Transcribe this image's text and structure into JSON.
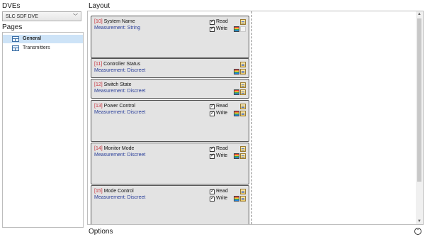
{
  "dves_header": "DVEs",
  "dve_selector": {
    "value": "SLC SDF DVE"
  },
  "pages_header": "Pages",
  "pages": [
    {
      "label": "General",
      "selected": true
    },
    {
      "label": "Transmitters",
      "selected": false
    }
  ],
  "layout_header": "Layout",
  "cards": [
    {
      "pid": "[10]",
      "name": "System Name",
      "measurement": "Measurement: String",
      "read_label": "Read",
      "write_label": "Write"
    },
    {
      "pid": "[11]",
      "name": "Controller Status",
      "measurement": "Measurement: Discreet"
    },
    {
      "pid": "[12]",
      "name": "Switch State",
      "measurement": "Measurement: Discreet"
    },
    {
      "pid": "[13]",
      "name": "Power Control",
      "measurement": "Measurement: Discreet",
      "read_label": "Read",
      "write_label": "Write"
    },
    {
      "pid": "[14]",
      "name": "Monitor Mode",
      "measurement": "Measurement: Discreet",
      "read_label": "Read",
      "write_label": "Write"
    },
    {
      "pid": "[15]",
      "name": "Mode Control",
      "measurement": "Measurement: Discreet",
      "read_label": "Read",
      "write_label": "Write"
    }
  ],
  "options_label": "Options"
}
